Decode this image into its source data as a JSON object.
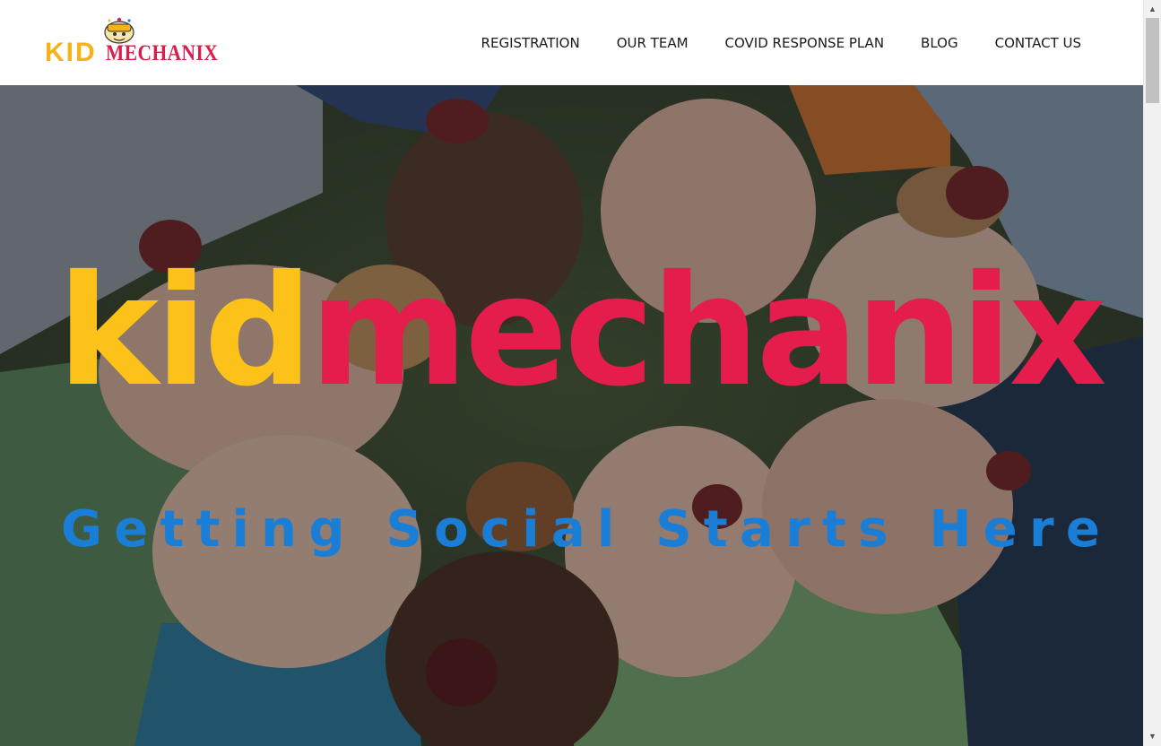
{
  "logo": {
    "kid": "KID",
    "mechanix": "MECHANIX"
  },
  "nav": {
    "items": [
      {
        "label": "REGISTRATION"
      },
      {
        "label": "OUR TEAM"
      },
      {
        "label": "COVID RESPONSE PLAN"
      },
      {
        "label": "BLOG"
      },
      {
        "label": "CONTACT US"
      }
    ]
  },
  "hero": {
    "title_kid": "kid",
    "title_mechanix": "mechanix",
    "tagline": "Getting Social Starts Here"
  },
  "colors": {
    "brand_yellow": "#fcc21a",
    "brand_red": "#e41d4c",
    "brand_blue": "#1a7ed6"
  },
  "icons": {
    "logo_mascot": "cartoon-mechanic-kid",
    "scroll_up": "triangle-up-icon",
    "scroll_down": "triangle-down-icon"
  }
}
